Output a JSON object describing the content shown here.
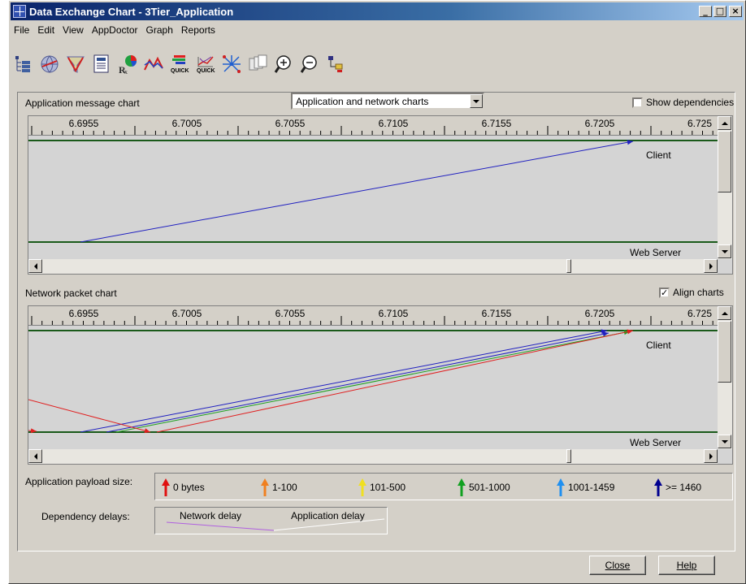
{
  "window": {
    "title": "Data Exchange Chart - 3Tier_Application",
    "controls": [
      "_",
      "□",
      "×"
    ]
  },
  "menu": [
    "File",
    "Edit",
    "View",
    "AppDoctor",
    "Graph",
    "Reports"
  ],
  "toolbar": {
    "icons": [
      "tree-view-icon",
      "network-globe-icon",
      "filter-icon",
      "summary-table-icon",
      "diagnosis-icon",
      "graph-icon",
      "quick-bar-icon",
      "quick-graph-icon",
      "topology-icon",
      "copy-icon",
      "zoom-in-icon",
      "zoom-out-icon",
      "network-nodes-icon"
    ],
    "quick_label": "QUICK"
  },
  "app_chart": {
    "label": "Application message chart",
    "view_select": "Application and network charts",
    "show_dependencies_label": "Show dependencies",
    "show_dependencies_checked": false,
    "top_node": "Client",
    "bottom_node": "Web Server"
  },
  "net_chart": {
    "label": "Network packet chart",
    "align_label": "Align charts",
    "align_checked": true,
    "top_node": "Client",
    "bottom_node": "Web Server"
  },
  "ruler": {
    "labels": [
      "6.6955",
      "6.7005",
      "6.7055",
      "6.7105",
      "6.7155",
      "6.7205",
      "6.725"
    ]
  },
  "chart_data": {
    "type": "line",
    "x_labels": [
      "6.6955",
      "6.7005",
      "6.7055",
      "6.7105",
      "6.7155",
      "6.7205",
      "6.725"
    ],
    "nodes": [
      "Client",
      "Web Server"
    ],
    "app_messages": [
      {
        "from": "Web Server",
        "to": "Client",
        "color": "#2020c0"
      }
    ],
    "network_packets": [
      {
        "from": "Web Server",
        "to": "Client",
        "color": "#2020c0"
      },
      {
        "from": "Web Server",
        "to": "Client",
        "color": "#2020c0"
      },
      {
        "from": "Web Server",
        "to": "Client",
        "color": "#20a020"
      },
      {
        "from": "Web Server",
        "to": "Client",
        "color": "#e02020"
      },
      {
        "from": "Client",
        "to": "Web Server",
        "color": "#e02020"
      }
    ]
  },
  "payload_legend": {
    "label": "Application payload size:",
    "items": [
      {
        "text": "0 bytes",
        "color": "#e01010"
      },
      {
        "text": "1-100",
        "color": "#f08020"
      },
      {
        "text": "101-500",
        "color": "#f0e020"
      },
      {
        "text": "501-1000",
        "color": "#10a020"
      },
      {
        "text": "1001-1459",
        "color": "#2090f0"
      },
      {
        "text": ">= 1460",
        "color": "#000090"
      }
    ]
  },
  "delay_legend": {
    "label": "Dependency delays:",
    "network": "Network delay",
    "application": "Application delay"
  },
  "buttons": {
    "close": "Close",
    "help": "Help"
  },
  "colors": {
    "titlebar": "#0a246a",
    "node_line": "#1a5a1a",
    "network_delay": "#b060e0",
    "application_delay": "#ffffff"
  }
}
